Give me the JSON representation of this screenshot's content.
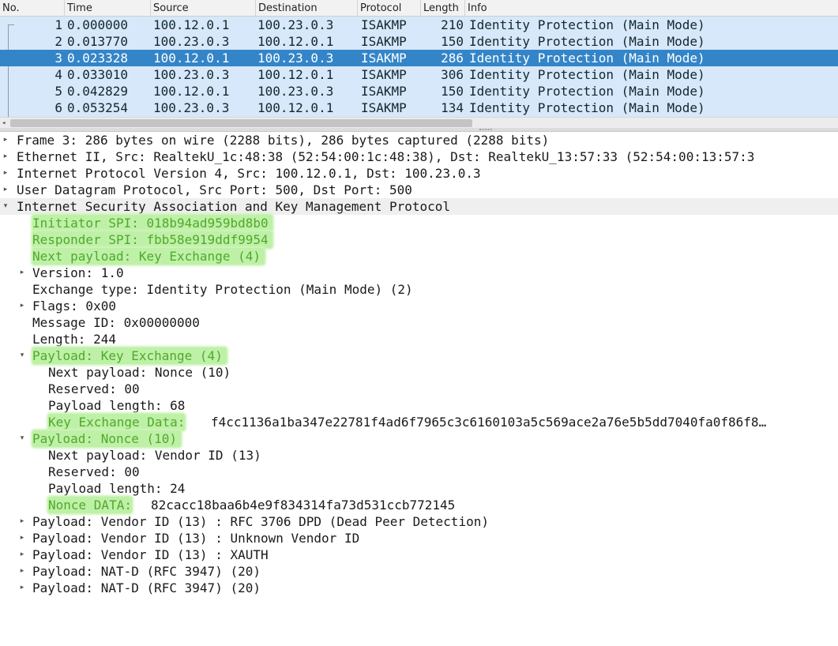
{
  "columns": [
    "No.",
    "Time",
    "Source",
    "Destination",
    "Protocol",
    "Length",
    "Info"
  ],
  "packets": [
    {
      "no": "1",
      "time": "0.000000",
      "src": "100.12.0.1",
      "dst": "100.23.0.3",
      "proto": "ISAKMP",
      "len": "210",
      "info": "Identity Protection (Main Mode)"
    },
    {
      "no": "2",
      "time": "0.013770",
      "src": "100.23.0.3",
      "dst": "100.12.0.1",
      "proto": "ISAKMP",
      "len": "150",
      "info": "Identity Protection (Main Mode)"
    },
    {
      "no": "3",
      "time": "0.023328",
      "src": "100.12.0.1",
      "dst": "100.23.0.3",
      "proto": "ISAKMP",
      "len": "286",
      "info": "Identity Protection (Main Mode)"
    },
    {
      "no": "4",
      "time": "0.033010",
      "src": "100.23.0.3",
      "dst": "100.12.0.1",
      "proto": "ISAKMP",
      "len": "306",
      "info": "Identity Protection (Main Mode)"
    },
    {
      "no": "5",
      "time": "0.042829",
      "src": "100.12.0.1",
      "dst": "100.23.0.3",
      "proto": "ISAKMP",
      "len": "150",
      "info": "Identity Protection (Main Mode)"
    },
    {
      "no": "6",
      "time": "0.053254",
      "src": "100.23.0.3",
      "dst": "100.12.0.1",
      "proto": "ISAKMP",
      "len": "134",
      "info": "Identity Protection (Main Mode)"
    }
  ],
  "selected_packet": "3",
  "details": {
    "frame": "Frame 3: 286 bytes on wire (2288 bits), 286 bytes captured (2288 bits)",
    "ethernet": "Ethernet II, Src: RealtekU_1c:48:38 (52:54:00:1c:48:38), Dst: RealtekU_13:57:33 (52:54:00:13:57:3",
    "ip": "Internet Protocol Version 4, Src: 100.12.0.1, Dst: 100.23.0.3",
    "udp": "User Datagram Protocol, Src Port: 500, Dst Port: 500",
    "isakmp": "Internet Security Association and Key Management Protocol",
    "initiator_spi": "Initiator SPI: 018b94ad959bd8b0",
    "responder_spi": "Responder SPI: fbb58e919ddf9954",
    "next_payload": "Next payload: Key Exchange (4)",
    "version": "Version: 1.0",
    "exchange_type": "Exchange type: Identity Protection (Main Mode) (2)",
    "flags": "Flags: 0x00",
    "message_id": "Message ID: 0x00000000",
    "length": "Length: 244",
    "payload_ke": "Payload: Key Exchange (4)",
    "ke_next_payload": "Next payload: Nonce (10)",
    "ke_reserved": "Reserved: 00",
    "ke_payload_length": "Payload length: 68",
    "ke_data_label": "Key Exchange Data:",
    "ke_data_value": "f4cc1136a1ba347e22781f4ad6f7965c3c6160103a5c569ace2a76e5b5dd7040fa0f86f8…",
    "payload_nonce": "Payload: Nonce (10)",
    "nonce_next_payload": "Next payload: Vendor ID (13)",
    "nonce_reserved": "Reserved: 00",
    "nonce_payload_length": "Payload length: 24",
    "nonce_data_label": "Nonce DATA:",
    "nonce_data_value": "82cacc18baa6b4e9f834314fa73d531ccb772145",
    "vendor_dpd": "Payload: Vendor ID (13) : RFC 3706 DPD (Dead Peer Detection)",
    "vendor_unknown": "Payload: Vendor ID (13) : Unknown Vendor ID",
    "vendor_xauth": "Payload: Vendor ID (13) : XAUTH",
    "nat_d_1": "Payload: NAT-D (RFC 3947) (20)",
    "nat_d_2": "Payload: NAT-D (RFC 3947) (20)"
  },
  "colors": {
    "list_background": "#d6e8f9",
    "selected_row": "#3485c7",
    "highlight": "#bff0a8",
    "highlight_text": "#4faa2a"
  }
}
